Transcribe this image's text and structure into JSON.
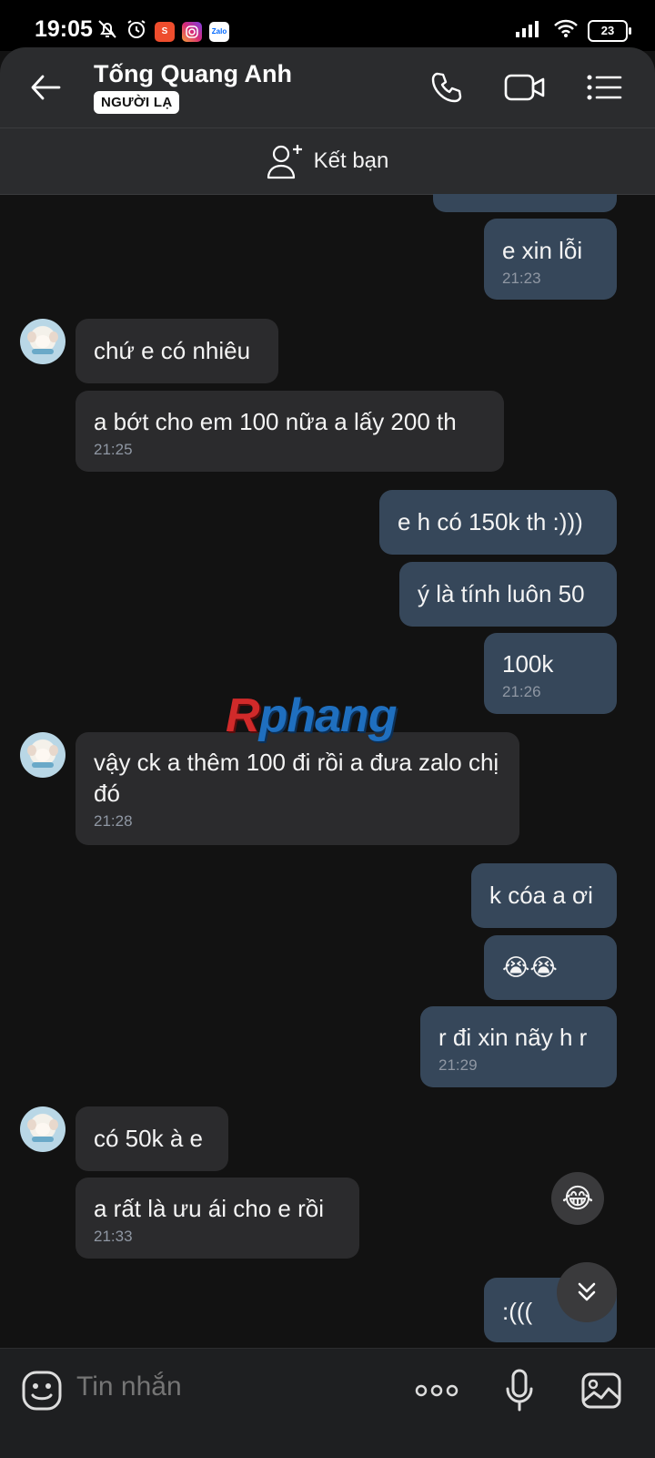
{
  "status": {
    "time": "19:05",
    "battery": "23",
    "zalo_label": "Zalo",
    "shopee_label": "S"
  },
  "header": {
    "name": "Tống Quang Anh",
    "badge": "NGƯỜI LẠ"
  },
  "friend_bar": {
    "label": "Kết bạn"
  },
  "messages": [
    {
      "dir": "out",
      "text": "e xin lỗi",
      "time": "21:23"
    },
    {
      "dir": "in",
      "text": "chứ e có nhiêu",
      "time": ""
    },
    {
      "dir": "in",
      "text": "a bớt cho em 100 nữa a lấy 200 th",
      "time": "21:25"
    },
    {
      "dir": "out",
      "text": "e h có 150k th :)))",
      "time": ""
    },
    {
      "dir": "out",
      "text": "ý là tính luôn 50",
      "time": ""
    },
    {
      "dir": "out",
      "text": "100k",
      "time": "21:26"
    },
    {
      "dir": "in",
      "text": "vậy ck a thêm 100 đi rồi a đưa zalo chị đó",
      "time": "21:28"
    },
    {
      "dir": "out",
      "text": "k cóa a ơi",
      "time": ""
    },
    {
      "dir": "out",
      "text": "😭😭",
      "time": ""
    },
    {
      "dir": "out",
      "text": "r đi xin nãy h r",
      "time": "21:29"
    },
    {
      "dir": "in",
      "text": "có 50k à e",
      "time": ""
    },
    {
      "dir": "in",
      "text": "a rất là ưu ái cho e rồi",
      "time": "21:33"
    },
    {
      "dir": "out",
      "text": ":(((",
      "time": ""
    }
  ],
  "reaction_emoji": "😂",
  "watermark": {
    "first": "R",
    "rest": "phang"
  },
  "composer": {
    "placeholder": "Tin nhắn"
  },
  "icons": [
    "back-arrow-icon",
    "phone-icon",
    "video-call-icon",
    "menu-list-icon",
    "add-friend-icon",
    "emoji-icon",
    "more-icon",
    "microphone-icon",
    "image-icon",
    "chevron-down-icon"
  ]
}
